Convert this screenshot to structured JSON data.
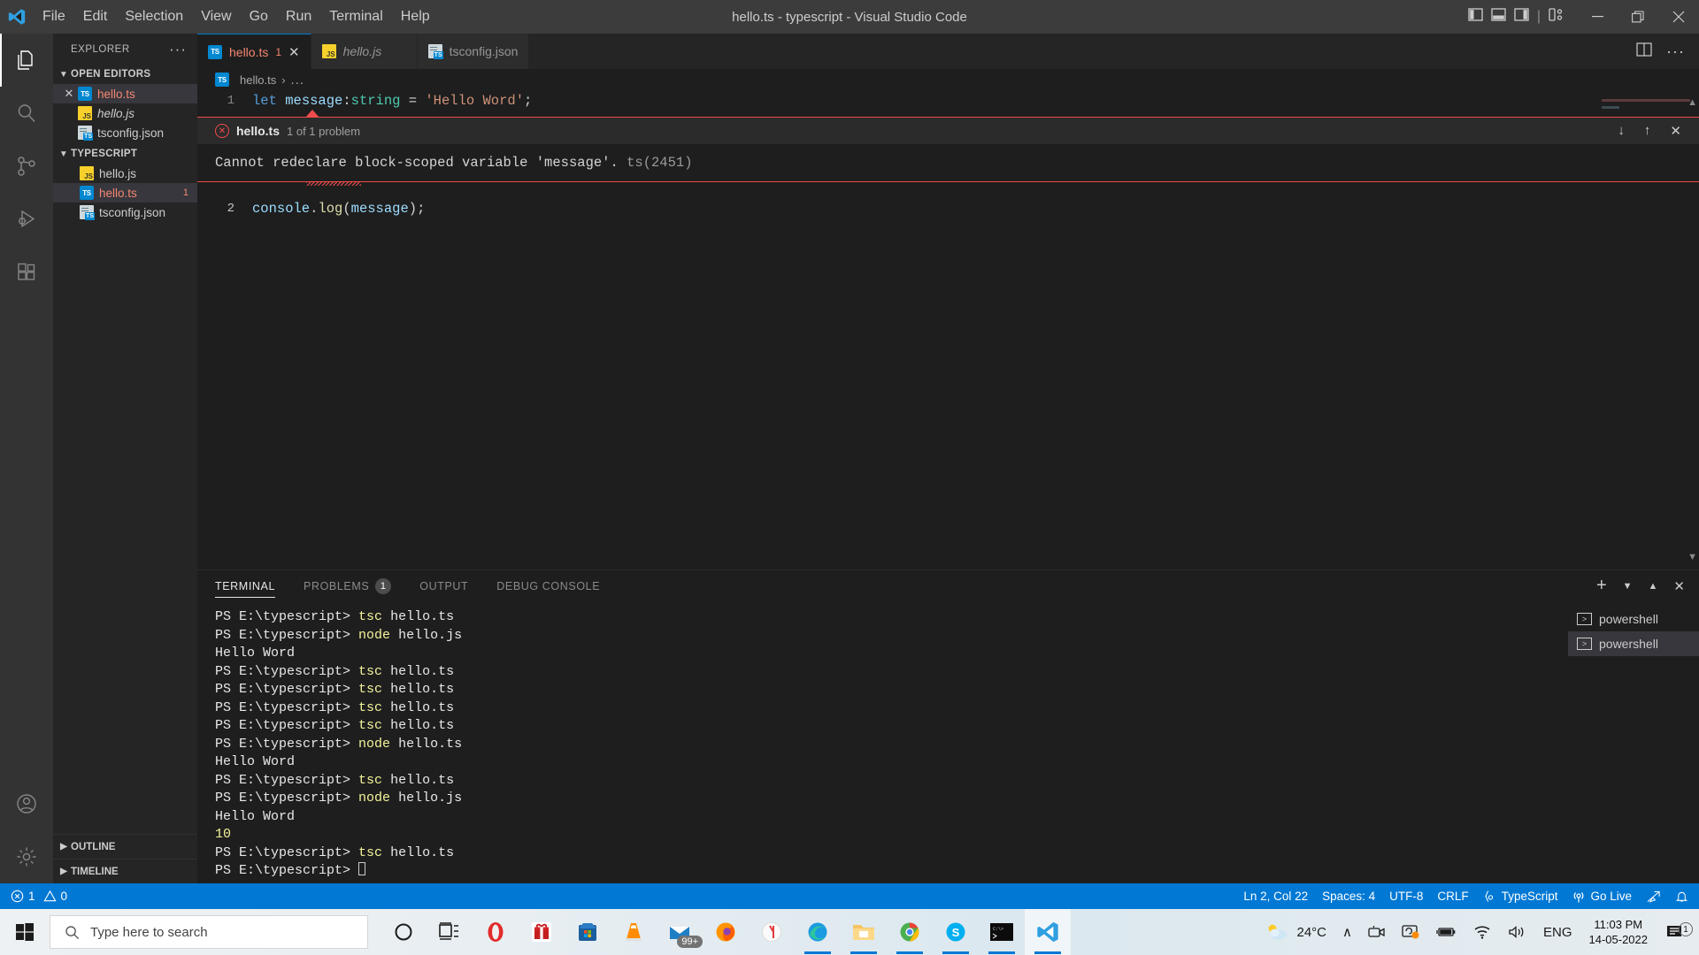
{
  "window": {
    "title": "hello.ts - typescript - Visual Studio Code",
    "menu": [
      "File",
      "Edit",
      "Selection",
      "View",
      "Go",
      "Run",
      "Terminal",
      "Help"
    ],
    "controls": {
      "minimize": "—",
      "maximize": "❐",
      "close": "✕"
    },
    "layout_icons": [
      "toggle-primary-sidebar",
      "toggle-panel",
      "toggle-secondary-sidebar",
      "customize-layout"
    ]
  },
  "activitybar": {
    "items": [
      {
        "name": "explorer",
        "icon": "files-icon",
        "active": true
      },
      {
        "name": "search",
        "icon": "search-icon",
        "active": false
      },
      {
        "name": "source-control",
        "icon": "source-control-icon",
        "active": false
      },
      {
        "name": "run-and-debug",
        "icon": "run-debug-icon",
        "active": false
      },
      {
        "name": "extensions",
        "icon": "extensions-icon",
        "active": false
      }
    ],
    "bottom": [
      {
        "name": "accounts",
        "icon": "account-icon"
      },
      {
        "name": "manage",
        "icon": "gear-icon"
      }
    ]
  },
  "sidebar": {
    "title": "EXPLORER",
    "more_actions": "···",
    "sections": [
      {
        "label": "OPEN EDITORS",
        "expanded": true,
        "items": [
          {
            "name": "hello.ts",
            "icon": "ts-file-icon",
            "error": true,
            "italic": false,
            "closable": true,
            "selected": true
          },
          {
            "name": "hello.js",
            "icon": "js-file-icon",
            "error": false,
            "italic": true,
            "closable": false,
            "selected": false
          },
          {
            "name": "tsconfig.json",
            "icon": "tsconfig-file-icon",
            "error": false,
            "italic": false,
            "closable": false,
            "selected": false
          }
        ]
      },
      {
        "label": "TYPESCRIPT",
        "expanded": true,
        "items": [
          {
            "name": "hello.js",
            "icon": "js-file-icon",
            "error": false,
            "italic": false,
            "closable": false,
            "selected": false,
            "badge": ""
          },
          {
            "name": "hello.ts",
            "icon": "ts-file-icon",
            "error": true,
            "italic": false,
            "closable": false,
            "selected": true,
            "badge": "1"
          },
          {
            "name": "tsconfig.json",
            "icon": "tsconfig-file-icon",
            "error": false,
            "italic": false,
            "closable": false,
            "selected": false,
            "badge": ""
          }
        ]
      }
    ],
    "collapsed_sections": [
      "OUTLINE",
      "TIMELINE"
    ]
  },
  "editor": {
    "tabs": [
      {
        "label": "hello.ts",
        "icon": "ts-file-icon",
        "active": true,
        "error": true,
        "italic": false,
        "count": "1",
        "close": "✕"
      },
      {
        "label": "hello.js",
        "icon": "js-file-icon",
        "active": false,
        "error": false,
        "italic": true,
        "count": "",
        "close": ""
      },
      {
        "label": "tsconfig.json",
        "icon": "tsconfig-file-icon",
        "active": false,
        "error": false,
        "italic": false,
        "count": "",
        "close": ""
      }
    ],
    "tab_actions": [
      "split-editor-icon",
      "more-actions-icon"
    ],
    "breadcrumb": {
      "file": "hello.ts",
      "separator": "›",
      "rest": "..."
    },
    "lines": [
      {
        "num": "1",
        "tokens": [
          {
            "t": "let ",
            "c": "kw"
          },
          {
            "t": "message",
            "c": "var"
          },
          {
            "t": ":",
            "c": "op"
          },
          {
            "t": "string",
            "c": "type"
          },
          {
            "t": " = ",
            "c": "op"
          },
          {
            "t": "'Hello Word'",
            "c": "str"
          },
          {
            "t": ";",
            "c": "plain"
          }
        ]
      },
      {
        "num": "2",
        "tokens": [
          {
            "t": "console",
            "c": "var"
          },
          {
            "t": ".",
            "c": "plain"
          },
          {
            "t": "log",
            "c": "fn"
          },
          {
            "t": "(",
            "c": "plain"
          },
          {
            "t": "message",
            "c": "var"
          },
          {
            "t": ")",
            "c": "plain"
          },
          {
            "t": ";",
            "c": "plain"
          }
        ]
      }
    ],
    "error_widget": {
      "file": "hello.ts",
      "problem_count": "1 of 1 problem",
      "message": "Cannot redeclare block-scoped variable 'message'.",
      "code": "ts(2451)",
      "actions": {
        "next": "↓",
        "previous": "↑",
        "close": "✕"
      }
    }
  },
  "panel": {
    "tabs": [
      {
        "label": "TERMINAL",
        "active": true,
        "badge": ""
      },
      {
        "label": "PROBLEMS",
        "active": false,
        "badge": "1"
      },
      {
        "label": "OUTPUT",
        "active": false,
        "badge": ""
      },
      {
        "label": "DEBUG CONSOLE",
        "active": false,
        "badge": ""
      }
    ],
    "actions": [
      "new-terminal-icon",
      "chevron-down-icon",
      "maximize-panel-icon",
      "close-panel-icon"
    ],
    "terminal_lines": [
      {
        "prompt": "PS E:\\typescript>",
        "cmd": "tsc ",
        "args": " hello.ts",
        "out": ""
      },
      {
        "prompt": "PS E:\\typescript>",
        "cmd": "node",
        "args": " hello.js",
        "out": ""
      },
      {
        "prompt": "",
        "cmd": "",
        "args": "",
        "out": "Hello Word"
      },
      {
        "prompt": "PS E:\\typescript>",
        "cmd": "tsc",
        "args": " hello.ts",
        "out": ""
      },
      {
        "prompt": "PS E:\\typescript>",
        "cmd": "tsc",
        "args": " hello.ts",
        "out": ""
      },
      {
        "prompt": "PS E:\\typescript>",
        "cmd": "tsc",
        "args": " hello.ts",
        "out": ""
      },
      {
        "prompt": "PS E:\\typescript>",
        "cmd": "tsc",
        "args": " hello.ts",
        "out": ""
      },
      {
        "prompt": "PS E:\\typescript>",
        "cmd": "node",
        "args": " hello.ts",
        "out": ""
      },
      {
        "prompt": "",
        "cmd": "",
        "args": "",
        "out": "Hello Word"
      },
      {
        "prompt": "PS E:\\typescript>",
        "cmd": "tsc",
        "args": " hello.ts",
        "out": ""
      },
      {
        "prompt": "PS E:\\typescript>",
        "cmd": "node",
        "args": " hello.js",
        "out": ""
      },
      {
        "prompt": "",
        "cmd": "",
        "args": "",
        "out": "Hello Word"
      },
      {
        "prompt": "",
        "cmd": "10",
        "args": "",
        "out": ""
      },
      {
        "prompt": "PS E:\\typescript>",
        "cmd": "tsc",
        "args": " hello.ts",
        "out": ""
      },
      {
        "prompt": "PS E:\\typescript>",
        "cmd": "",
        "args": "",
        "out": "",
        "cursor": true
      }
    ],
    "terminal_instances": [
      {
        "label": "powershell",
        "active": false
      },
      {
        "label": "powershell",
        "active": true
      }
    ]
  },
  "statusbar": {
    "errors": "1",
    "warnings": "0",
    "position": "Ln 2, Col 22",
    "spaces": "Spaces: 4",
    "encoding": "UTF-8",
    "eol": "CRLF",
    "language": "TypeScript",
    "golive": "Go Live",
    "icons": [
      "error-icon",
      "warning-icon",
      "braces-icon",
      "broadcast-icon",
      "remote-icon",
      "bell-icon"
    ]
  },
  "taskbar": {
    "search_placeholder": "Type here to search",
    "apps": [
      {
        "name": "cortana-icon",
        "running": false
      },
      {
        "name": "task-view-icon",
        "running": false
      },
      {
        "name": "opera-icon",
        "running": false
      },
      {
        "name": "gift-icon",
        "running": false
      },
      {
        "name": "microsoft-store-icon",
        "running": false
      },
      {
        "name": "vlc-icon",
        "running": false
      },
      {
        "name": "mail-icon",
        "running": false,
        "badge": "99+"
      },
      {
        "name": "firefox-icon",
        "running": false
      },
      {
        "name": "yandex-icon",
        "running": false
      },
      {
        "name": "edge-icon",
        "running": true
      },
      {
        "name": "file-explorer-icon",
        "running": true
      },
      {
        "name": "chrome-icon",
        "running": true
      },
      {
        "name": "skype-icon",
        "running": true
      },
      {
        "name": "terminal-icon",
        "running": true
      },
      {
        "name": "vscode-icon",
        "running": true,
        "active": true
      }
    ],
    "tray": {
      "weather": "24°C",
      "weather_icon": "sun-cloud-icon",
      "chevron": "∧",
      "items": [
        "camera-icon",
        "sync-icon",
        "battery-icon",
        "wifi-icon",
        "volume-icon"
      ],
      "language": "ENG",
      "time": "11:03 PM",
      "date": "14-05-2022",
      "notification_count": "1"
    }
  },
  "colors": {
    "accent": "#0078d4",
    "error": "#f14c4c",
    "error_text": "#f48771",
    "titlebar": "#3c3c3c",
    "sidebar": "#252526",
    "editor": "#1e1e1e",
    "activitybar": "#333333"
  }
}
